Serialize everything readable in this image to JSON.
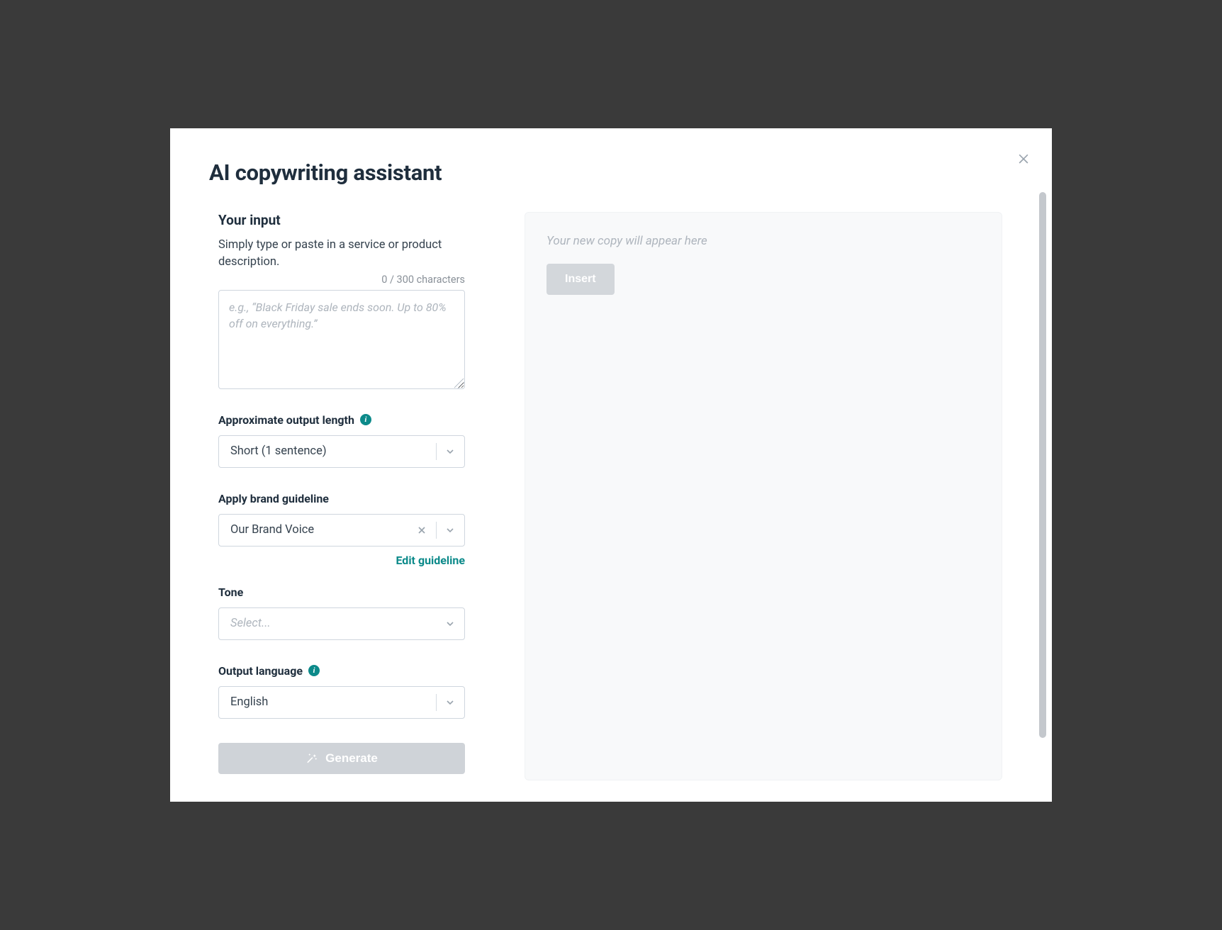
{
  "modal": {
    "title": "AI copywriting assistant"
  },
  "left": {
    "heading": "Your input",
    "description": "Simply type or paste in a service or product description.",
    "char_counter": "0 / 300 characters",
    "textarea_placeholder": "e.g., “Black Friday sale ends soon. Up to 80% off on everything.”",
    "textarea_value": "",
    "fields": {
      "output_length": {
        "label": "Approximate output length",
        "selected": "Short (1 sentence)"
      },
      "brand_guideline": {
        "label": "Apply brand guideline",
        "selected": "Our Brand Voice",
        "edit_link": "Edit guideline"
      },
      "tone": {
        "label": "Tone",
        "placeholder": "Select..."
      },
      "language": {
        "label": "Output language",
        "selected": "English"
      }
    },
    "generate_label": "Generate"
  },
  "right": {
    "placeholder": "Your new copy will appear here",
    "insert_label": "Insert"
  },
  "icons": {
    "info": "i"
  }
}
